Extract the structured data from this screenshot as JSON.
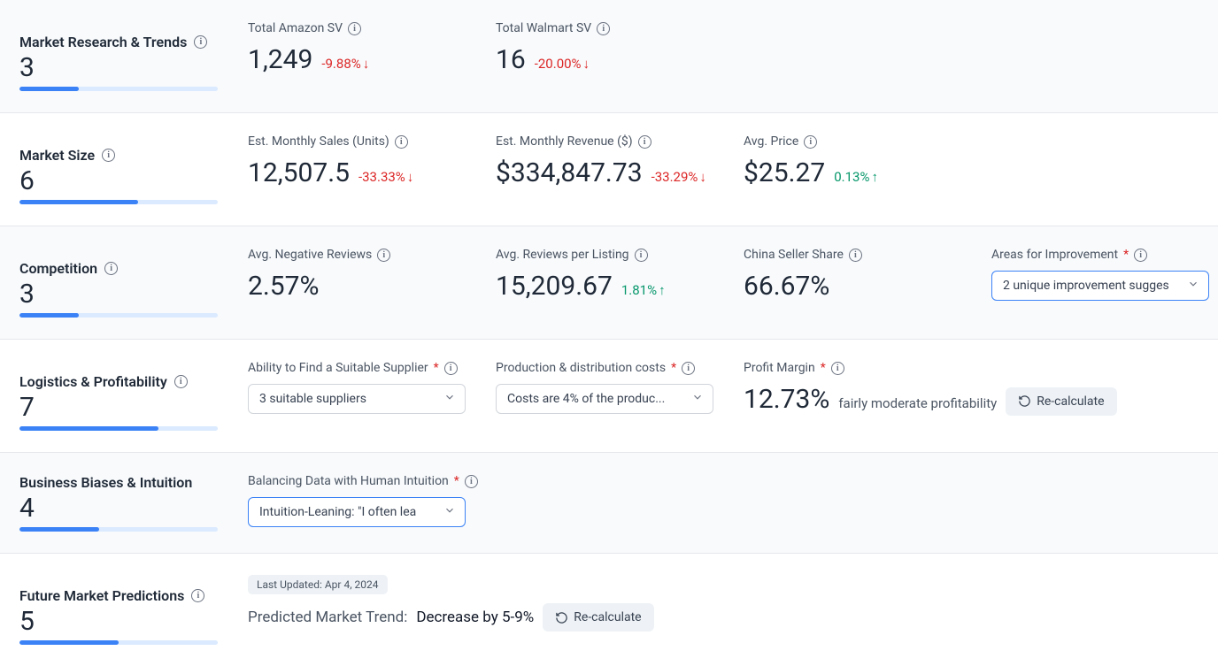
{
  "sections": {
    "research": {
      "title": "Market Research & Trends",
      "score": "3",
      "progress": 30,
      "metrics": [
        {
          "label": "Total Amazon SV",
          "value": "1,249",
          "delta": "-9.88%",
          "dir": "down"
        },
        {
          "label": "Total Walmart SV",
          "value": "16",
          "delta": "-20.00%",
          "dir": "down"
        }
      ]
    },
    "size": {
      "title": "Market Size",
      "score": "6",
      "progress": 60,
      "metrics": [
        {
          "label": "Est. Monthly Sales (Units)",
          "value": "12,507.5",
          "delta": "-33.33%",
          "dir": "down"
        },
        {
          "label": "Est. Monthly Revenue ($)",
          "value": "$334,847.73",
          "delta": "-33.29%",
          "dir": "down"
        },
        {
          "label": "Avg. Price",
          "value": "$25.27",
          "delta": "0.13%",
          "dir": "up"
        }
      ]
    },
    "competition": {
      "title": "Competition",
      "score": "3",
      "progress": 30,
      "metrics": [
        {
          "label": "Avg. Negative Reviews",
          "value": "2.57%",
          "delta": "",
          "dir": ""
        },
        {
          "label": "Avg. Reviews per Listing",
          "value": "15,209.67",
          "delta": "1.81%",
          "dir": "up"
        },
        {
          "label": "China Seller Share",
          "value": "66.67%",
          "delta": "",
          "dir": ""
        }
      ],
      "improvement_label": "Areas for Improvement",
      "improvement_value": "2 unique improvement sugges"
    },
    "logistics": {
      "title": "Logistics & Profitability",
      "score": "7",
      "progress": 70,
      "supplier_label": "Ability to Find a Suitable Supplier",
      "supplier_value": "3 suitable suppliers",
      "costs_label": "Production & distribution costs",
      "costs_value": "Costs are 4% of the produc...",
      "margin_label": "Profit Margin",
      "margin_value": "12.73%",
      "margin_note": "fairly moderate profitability",
      "recalc": "Re-calculate"
    },
    "bias": {
      "title": "Business Biases & Intuition",
      "score": "4",
      "progress": 40,
      "balancing_label": "Balancing Data with Human Intuition",
      "balancing_value": "Intuition-Leaning: \"I often lea"
    },
    "future": {
      "title": "Future Market Predictions",
      "score": "5",
      "progress": 50,
      "updated": "Last Updated: Apr 4, 2024",
      "predicted_label": "Predicted Market Trend:",
      "predicted_value": "Decrease by 5-9%",
      "recalc": "Re-calculate"
    }
  }
}
